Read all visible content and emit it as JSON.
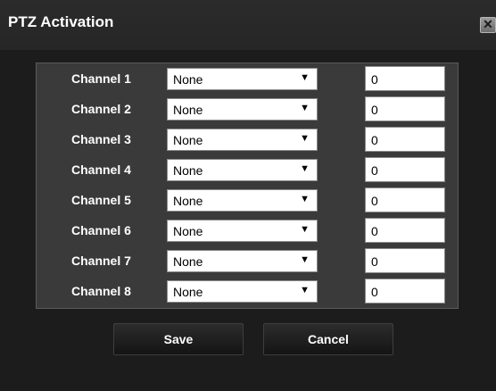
{
  "dialog": {
    "title": "PTZ Activation",
    "close_label": "✕"
  },
  "channels": [
    {
      "label": "Channel 1",
      "select_value": "None",
      "input_value": "0"
    },
    {
      "label": "Channel 2",
      "select_value": "None",
      "input_value": "0"
    },
    {
      "label": "Channel 3",
      "select_value": "None",
      "input_value": "0"
    },
    {
      "label": "Channel 4",
      "select_value": "None",
      "input_value": "0"
    },
    {
      "label": "Channel 5",
      "select_value": "None",
      "input_value": "0"
    },
    {
      "label": "Channel 6",
      "select_value": "None",
      "input_value": "0"
    },
    {
      "label": "Channel 7",
      "select_value": "None",
      "input_value": "0"
    },
    {
      "label": "Channel 8",
      "select_value": "None",
      "input_value": "0"
    }
  ],
  "arrow_icon": "▼",
  "buttons": {
    "save_label": "Save",
    "cancel_label": "Cancel"
  }
}
